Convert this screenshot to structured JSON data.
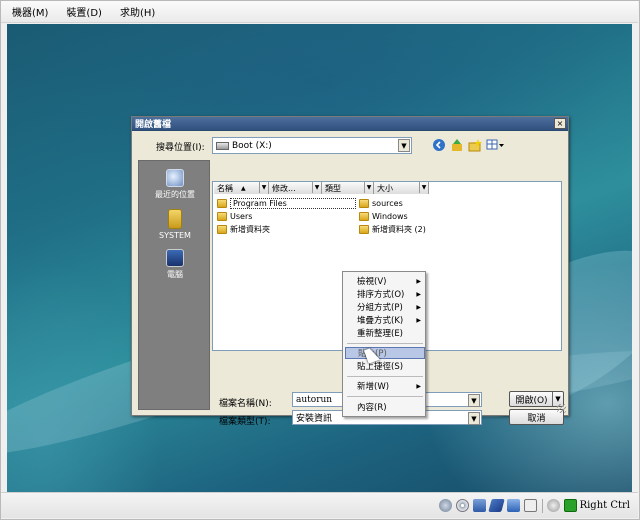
{
  "menubar": {
    "items": [
      "機器(M)",
      "裝置(D)",
      "求助(H)"
    ]
  },
  "statusbar": {
    "host_key": "Right Ctrl",
    "icons": [
      "hard-disk-icon",
      "cd-icon",
      "network-icon",
      "usb-icon",
      "shared-folder-icon",
      "display-icon",
      "mouse-integration-icon",
      "host-key-indicator-icon"
    ]
  },
  "dialog": {
    "title": "開啟舊檔",
    "close_label": "×",
    "look_in_label": "搜尋位置(I):",
    "look_in_value": "Boot (X:)",
    "places": [
      {
        "label": "最近的位置",
        "icon": "recent-places-icon"
      },
      {
        "label": "SYSTEM",
        "icon": "user-folder-icon"
      },
      {
        "label": "電腦",
        "icon": "computer-icon"
      }
    ],
    "columns": [
      "名稱",
      "修改...",
      "類型",
      "大小"
    ],
    "files_left": [
      "Program Files",
      "Users",
      "新增資料夾"
    ],
    "files_right": [
      "sources",
      "Windows",
      "新增資料夾 (2)"
    ],
    "filename_label": "檔案名稱(N):",
    "filename_value": "autorun",
    "filetype_label": "檔案類型(T):",
    "filetype_value": "安裝資訊",
    "open_button": "開啟(O)",
    "cancel_button": "取消"
  },
  "context_menu": {
    "items": [
      {
        "label": "檢視(V)",
        "submenu": true
      },
      {
        "label": "排序方式(O)",
        "submenu": true
      },
      {
        "label": "分組方式(P)",
        "submenu": true
      },
      {
        "label": "堆疊方式(K)",
        "submenu": true
      },
      {
        "label": "重新整理(E)",
        "submenu": false
      },
      {
        "label": "貼上(P)",
        "submenu": false,
        "highlighted": true
      },
      {
        "label": "貼上捷徑(S)",
        "submenu": false
      },
      {
        "label": "新增(W)",
        "submenu": true
      },
      {
        "label": "內容(R)",
        "submenu": false
      }
    ],
    "submenu_arrow": "▶"
  },
  "colors": {
    "title_bar": "#31517f",
    "dialog_bg": "#ece9d8",
    "menu_highlight": "#b8c7e6",
    "desktop": "#1f6e86"
  }
}
